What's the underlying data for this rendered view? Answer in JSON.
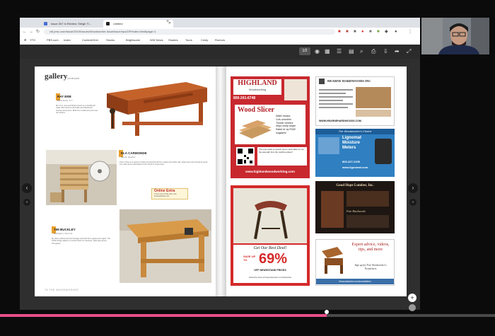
{
  "browser": {
    "tabs": [
      {
        "label": "Issue 307 In Review: Sleigh Ti..."
      },
      {
        "label": "Untitled"
      }
    ],
    "url": "cdl.pmc.com/Issue/2019/Issues/Woodworker-Issue/issue/eps/ZIP/index.html#page=1",
    "bookmarks": [
      "YTD",
      "PBS.com",
      "Index",
      "Content/Grid",
      "Stocks",
      "Brightsome",
      "WW News",
      "Shades",
      "Tours",
      "Cindy",
      "Rumors"
    ]
  },
  "reader": {
    "page_indicator": "1/2",
    "bottom_progress": 0.66,
    "nav_prev": "‹",
    "nav_next": "›",
    "expand_label": "+"
  },
  "left_page": {
    "section": "gallery",
    "section_sub": "continued",
    "footer": "78  THE WOODWORKER",
    "items": [
      {
        "maker": "RAY ERB",
        "location": "Black Rock, N.Y.",
        "body": "My 12-in. vise and Roubo bench as a workbench made with hand-cut dovetails and drawbored mortise-and-tenons. Built from reclaimed wood over two winters."
      },
      {
        "maker": "ELA CARMONDE",
        "location": "Mount, Quebec",
        "body": "This is three of a series of chairs and stools built from walnut and white oak, steam-bent and carved by hand. The seat woven with Danish cord. Finish is oil and wax.",
        "extra": "Online Extra",
        "extra_sub": "To see more of this stool, visit thewoodworker.com"
      },
      {
        "maker": "TIM BUCKLEY",
        "location": "Burlington, Vermont",
        "body": "My plane cabinet and tool storage rack built from sapele and maple. The trestle design allows it to knock down for transport. Hide glue joinery throughout."
      }
    ]
  },
  "ads": {
    "highland": {
      "brand": "HIGHLAND",
      "brand_sub": "Woodworking",
      "phone": "800-241-6748",
      "product": "Wood Slicer",
      "claims": [
        "Wider resaws",
        "Cuts smoother",
        "Thinner veneers",
        "Stays sharp longer",
        "Rated #1 by FWW magazine"
      ],
      "quote": "The only resaw on guard I feel is much faster to cut the saw-right from the machine planer!",
      "website": "www.highlandwoodworking.com"
    },
    "hearne": {
      "brand": "HEARNE HARDWOODS INC",
      "website": "WWW.HEARNEHARDWOODS.COM"
    },
    "lignomat": {
      "header": "The Woodworker's Choice",
      "title": "Lignomat Moisture Meters",
      "phone": "800-227-2105",
      "website": "www.lignomat.com"
    },
    "good_hope": {
      "brand": "Good Hope Lumber, Inc.",
      "tagline": "Fine Hardwoods"
    },
    "subscribe": {
      "headline": "Get Our Best Deal!",
      "save_label": "SAVE UP TO",
      "percent": "69%",
      "off_text": "OFF NEWSSTAND PRICES",
      "footer": "Subscribe Now at thewoodworker.com/subscribe"
    },
    "expert": {
      "text": "Expert advice, videos, tips, and more",
      "signup": "Sign up for Free Woodworker's Newsletters",
      "footer": "thewoodworker.com/newsletters"
    }
  },
  "colors": {
    "highland_red": "#c8292f",
    "sub_red": "#d42a2a",
    "lignomat_blue": "#2f7fc1",
    "progress_pink": "#e94f8a",
    "gallery_orange": "#e8a030"
  }
}
